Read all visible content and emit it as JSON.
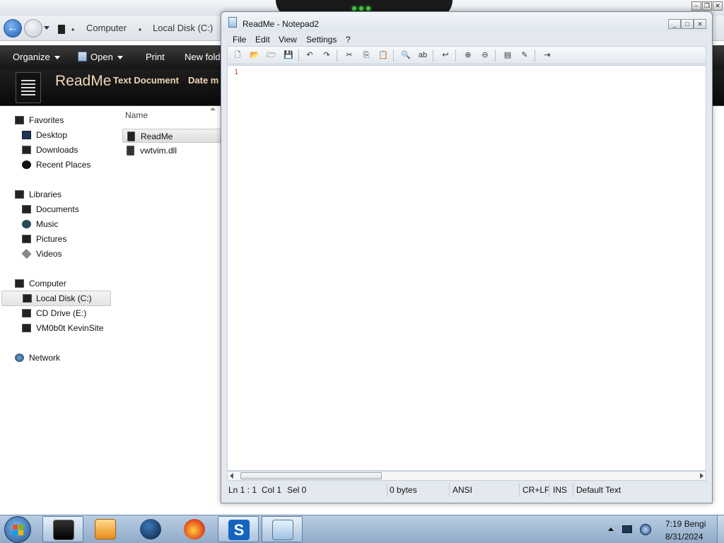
{
  "explorer": {
    "breadcrumb": [
      "Computer",
      "Local Disk (C:)"
    ],
    "toolbar": {
      "organize": "Organize",
      "open": "Open",
      "print": "Print",
      "new_folder": "New folde"
    },
    "details": {
      "name": "ReadMe",
      "type": "Text Document",
      "date": "Date m"
    },
    "nav": {
      "favorites": "Favorites",
      "desktop": "Desktop",
      "downloads": "Downloads",
      "recent": "Recent Places",
      "libraries": "Libraries",
      "documents": "Documents",
      "music": "Music",
      "pictures": "Pictures",
      "videos": "Videos",
      "computer": "Computer",
      "local_disk": "Local Disk (C:)",
      "cd_drive": "CD Drive (E:)",
      "vm": "VM0b0t KevinSite",
      "network": "Network"
    },
    "files": {
      "column_name": "Name",
      "items": [
        "ReadMe",
        "vwtvim.dll"
      ]
    }
  },
  "notepad": {
    "title": "ReadMe - Notepad2",
    "menu": [
      "File",
      "Edit",
      "View",
      "Settings",
      "?"
    ],
    "line_number": "1",
    "status": {
      "position": "Ln 1 : 1",
      "col": "Col 1",
      "sel": "Sel 0",
      "size": "0 bytes",
      "encoding": "ANSI",
      "eol": "CR+LF",
      "mode": "INS",
      "scheme": "Default Text"
    }
  },
  "taskbar": {
    "time": "7:19 Bengi",
    "date": "8/31/2024"
  },
  "colors": {
    "toolbar_bg": "#1a1a1a",
    "details_text": "#f0d7b8",
    "line_number": "#c0392b",
    "taskbar": "#a6bfd8"
  }
}
